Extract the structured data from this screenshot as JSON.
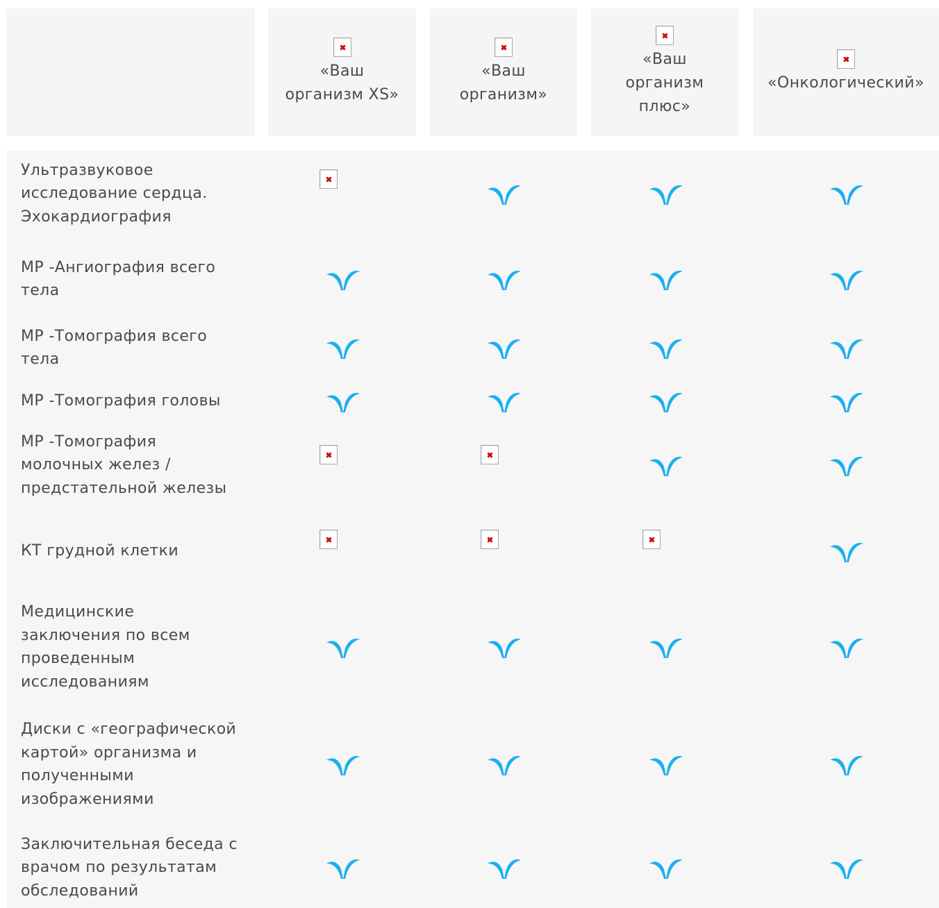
{
  "colors": {
    "check": "#1ab0ee",
    "header_bg": "#f5f5f5",
    "table_bg": "#f6f6f6",
    "text": "#4a4a4a"
  },
  "columns": [
    {
      "label": "«Ваш\nорганизм XS»",
      "icon": "broken-image-icon"
    },
    {
      "label": "«Ваш\nорганизм»",
      "icon": "broken-image-icon"
    },
    {
      "label": "«Ваш\nорганизм\nплюс»",
      "icon": "broken-image-icon"
    },
    {
      "label": "«Онкологический»",
      "icon": "broken-image-icon"
    }
  ],
  "rows": [
    {
      "label": " Ультразвуковое\nисследование сердца.\nЭхокардиография",
      "cells": [
        "broken",
        "check",
        "check",
        "check"
      ]
    },
    {
      "label": "МР -Ангиография всего\nтела",
      "cells": [
        "check",
        "check",
        "check",
        "check"
      ]
    },
    {
      "label": "МР -Томография всего\nтела",
      "cells": [
        "check",
        "check",
        "check",
        "check"
      ]
    },
    {
      "label": "МР -Томография головы",
      "cells": [
        "check",
        "check",
        "check",
        "check"
      ]
    },
    {
      "label": "МР -Томография\nмолочных желез /\nпредстательной железы",
      "cells": [
        "broken",
        "broken",
        "check",
        "check"
      ]
    },
    {
      "label": "КТ грудной клетки",
      "cells": [
        "broken",
        "broken",
        "broken",
        "check"
      ]
    },
    {
      "label": "Медицинские\nзаключения по всем\nпроведенным\nисследованиям",
      "cells": [
        "check",
        "check",
        "check",
        "check"
      ]
    },
    {
      "label": "Диски с «географической\nкартой» организма и\nполученными\nизображениями",
      "cells": [
        "check",
        "check",
        "check",
        "check"
      ]
    },
    {
      "label": "Заключительная беседа с\nврачом по результатам\nобследований",
      "cells": [
        "check",
        "check",
        "check",
        "check"
      ]
    }
  ]
}
